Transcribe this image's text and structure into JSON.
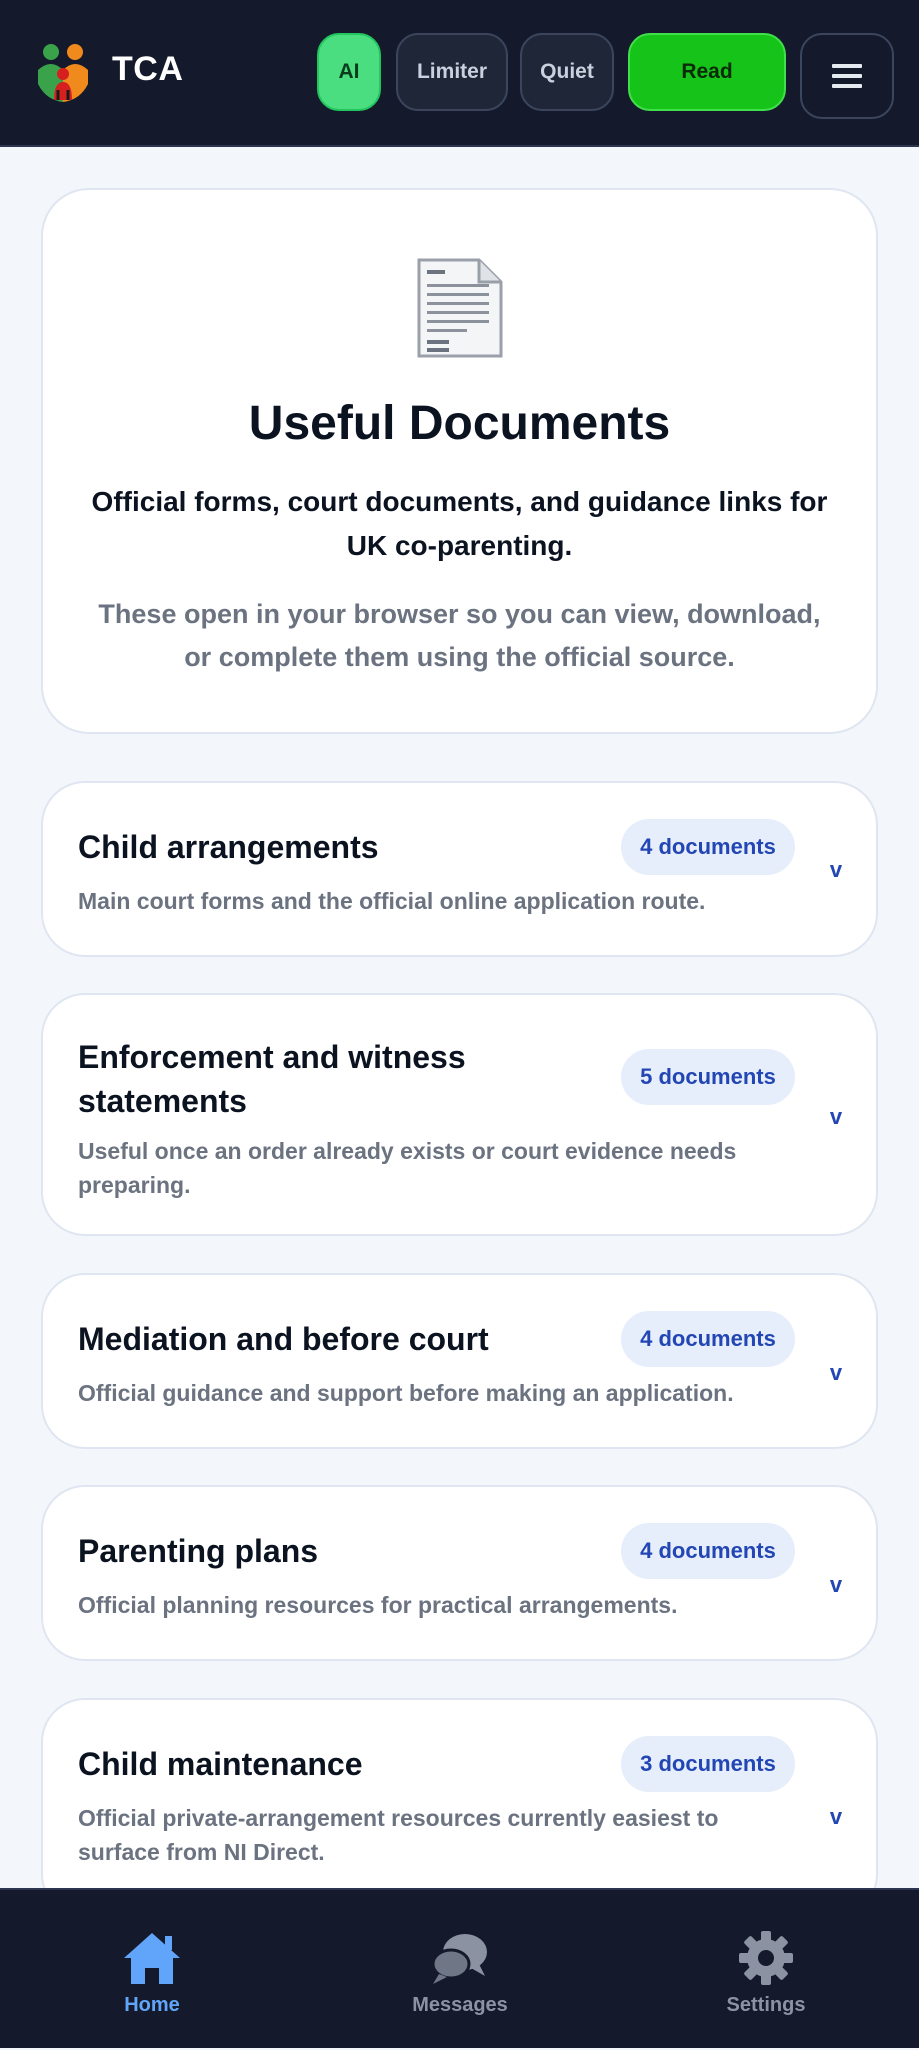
{
  "header": {
    "title": "TCA",
    "pills": {
      "ai": "AI",
      "limiter": "Limiter",
      "quiet": "Quiet",
      "read": "Read"
    },
    "menu_icon": "hamburger-icon",
    "logo_icon": "family-logo-icon"
  },
  "hero": {
    "icon": "document-icon",
    "title": "Useful Documents",
    "subtitle": "Official forms, court documents, and guidance links for UK co-parenting.",
    "note": "These open in your browser so you can view, download, or complete them using the official source."
  },
  "categories": [
    {
      "title": "Child arrangements",
      "count": "4 documents",
      "description": "Main court forms and the official online application route."
    },
    {
      "title": "Enforcement and witness statements",
      "count": "5 documents",
      "description": "Useful once an order already exists or court evidence needs preparing."
    },
    {
      "title": "Mediation and before court",
      "count": "4 documents",
      "description": "Official guidance and support before making an application."
    },
    {
      "title": "Parenting plans",
      "count": "4 documents",
      "description": "Official planning resources for practical arrangements."
    },
    {
      "title": "Child maintenance",
      "count": "3 documents",
      "description": "Official private-arrangement resources currently easiest to surface from NI Direct."
    }
  ],
  "chevron_glyph": "v",
  "tabbar": {
    "home": "Home",
    "messages": "Messages",
    "settings": "Settings",
    "active": "home"
  },
  "colors": {
    "active_tab": "#60a5fa",
    "inactive_tab": "#8b93a3",
    "ai_pill": "#4ade80",
    "read_pill": "#16c318",
    "badge_text": "#2246b4"
  }
}
